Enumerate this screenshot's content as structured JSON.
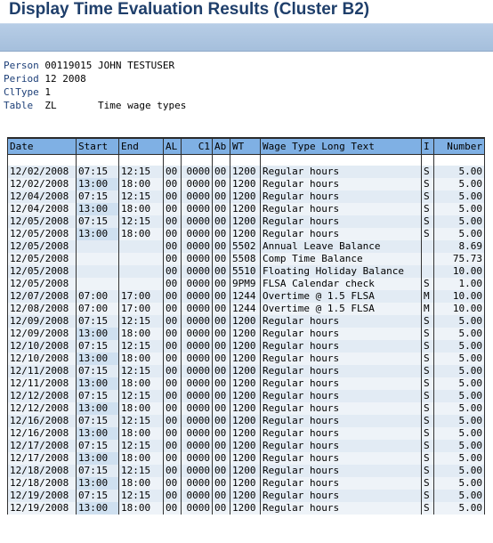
{
  "window": {
    "title": "Display Time Evaluation Results (Cluster B2)"
  },
  "header": {
    "person_label": "Person",
    "person_value": "00119015 JOHN TESTUSER",
    "period_label": "Period",
    "period_value": "12 2008",
    "cltype_label": "ClType",
    "cltype_value": "1",
    "table_label": "Table",
    "table_value": "ZL",
    "table_desc": "Time wage types"
  },
  "columns": [
    "Date",
    "Start",
    "End",
    "AL",
    "C1",
    "Ab",
    "WT",
    "Wage Type Long Text",
    "I",
    "Number"
  ],
  "rows": [
    [
      "12/02/2008",
      "07:15",
      "12:15",
      "00",
      "0000",
      "00",
      "1200",
      "Regular hours",
      "S",
      "5.00"
    ],
    [
      "12/02/2008",
      "13:00",
      "18:00",
      "00",
      "0000",
      "00",
      "1200",
      "Regular hours",
      "S",
      "5.00"
    ],
    [
      "12/04/2008",
      "07:15",
      "12:15",
      "00",
      "0000",
      "00",
      "1200",
      "Regular hours",
      "S",
      "5.00"
    ],
    [
      "12/04/2008",
      "13:00",
      "18:00",
      "00",
      "0000",
      "00",
      "1200",
      "Regular hours",
      "S",
      "5.00"
    ],
    [
      "12/05/2008",
      "07:15",
      "12:15",
      "00",
      "0000",
      "00",
      "1200",
      "Regular hours",
      "S",
      "5.00"
    ],
    [
      "12/05/2008",
      "13:00",
      "18:00",
      "00",
      "0000",
      "00",
      "1200",
      "Regular hours",
      "S",
      "5.00"
    ],
    [
      "12/05/2008",
      "",
      "",
      "00",
      "0000",
      "00",
      "5502",
      "Annual Leave Balance",
      "",
      "8.69"
    ],
    [
      "12/05/2008",
      "",
      "",
      "00",
      "0000",
      "00",
      "5508",
      "Comp Time Balance",
      "",
      "75.73"
    ],
    [
      "12/05/2008",
      "",
      "",
      "00",
      "0000",
      "00",
      "5510",
      "Floating Holiday Balance",
      "",
      "10.00"
    ],
    [
      "12/05/2008",
      "",
      "",
      "00",
      "0000",
      "00",
      "9PM9",
      "FLSA Calendar check",
      "S",
      "1.00"
    ],
    [
      "12/07/2008",
      "07:00",
      "17:00",
      "00",
      "0000",
      "00",
      "1244",
      "Overtime @ 1.5 FLSA",
      "M",
      "10.00"
    ],
    [
      "12/08/2008",
      "07:00",
      "17:00",
      "00",
      "0000",
      "00",
      "1244",
      "Overtime @ 1.5 FLSA",
      "M",
      "10.00"
    ],
    [
      "12/09/2008",
      "07:15",
      "12:15",
      "00",
      "0000",
      "00",
      "1200",
      "Regular hours",
      "S",
      "5.00"
    ],
    [
      "12/09/2008",
      "13:00",
      "18:00",
      "00",
      "0000",
      "00",
      "1200",
      "Regular hours",
      "S",
      "5.00"
    ],
    [
      "12/10/2008",
      "07:15",
      "12:15",
      "00",
      "0000",
      "00",
      "1200",
      "Regular hours",
      "S",
      "5.00"
    ],
    [
      "12/10/2008",
      "13:00",
      "18:00",
      "00",
      "0000",
      "00",
      "1200",
      "Regular hours",
      "S",
      "5.00"
    ],
    [
      "12/11/2008",
      "07:15",
      "12:15",
      "00",
      "0000",
      "00",
      "1200",
      "Regular hours",
      "S",
      "5.00"
    ],
    [
      "12/11/2008",
      "13:00",
      "18:00",
      "00",
      "0000",
      "00",
      "1200",
      "Regular hours",
      "S",
      "5.00"
    ],
    [
      "12/12/2008",
      "07:15",
      "12:15",
      "00",
      "0000",
      "00",
      "1200",
      "Regular hours",
      "S",
      "5.00"
    ],
    [
      "12/12/2008",
      "13:00",
      "18:00",
      "00",
      "0000",
      "00",
      "1200",
      "Regular hours",
      "S",
      "5.00"
    ],
    [
      "12/16/2008",
      "07:15",
      "12:15",
      "00",
      "0000",
      "00",
      "1200",
      "Regular hours",
      "S",
      "5.00"
    ],
    [
      "12/16/2008",
      "13:00",
      "18:00",
      "00",
      "0000",
      "00",
      "1200",
      "Regular hours",
      "S",
      "5.00"
    ],
    [
      "12/17/2008",
      "07:15",
      "12:15",
      "00",
      "0000",
      "00",
      "1200",
      "Regular hours",
      "S",
      "5.00"
    ],
    [
      "12/17/2008",
      "13:00",
      "18:00",
      "00",
      "0000",
      "00",
      "1200",
      "Regular hours",
      "S",
      "5.00"
    ],
    [
      "12/18/2008",
      "07:15",
      "12:15",
      "00",
      "0000",
      "00",
      "1200",
      "Regular hours",
      "S",
      "5.00"
    ],
    [
      "12/18/2008",
      "13:00",
      "18:00",
      "00",
      "0000",
      "00",
      "1200",
      "Regular hours",
      "S",
      "5.00"
    ],
    [
      "12/19/2008",
      "07:15",
      "12:15",
      "00",
      "0000",
      "00",
      "1200",
      "Regular hours",
      "S",
      "5.00"
    ],
    [
      "12/19/2008",
      "13:00",
      "18:00",
      "00",
      "0000",
      "00",
      "1200",
      "Regular hours",
      "S",
      "5.00"
    ]
  ],
  "colors": {
    "title": "#1f3f6b",
    "header_bg": "#7fb0e4",
    "toolbar": "#a5bfdc"
  }
}
